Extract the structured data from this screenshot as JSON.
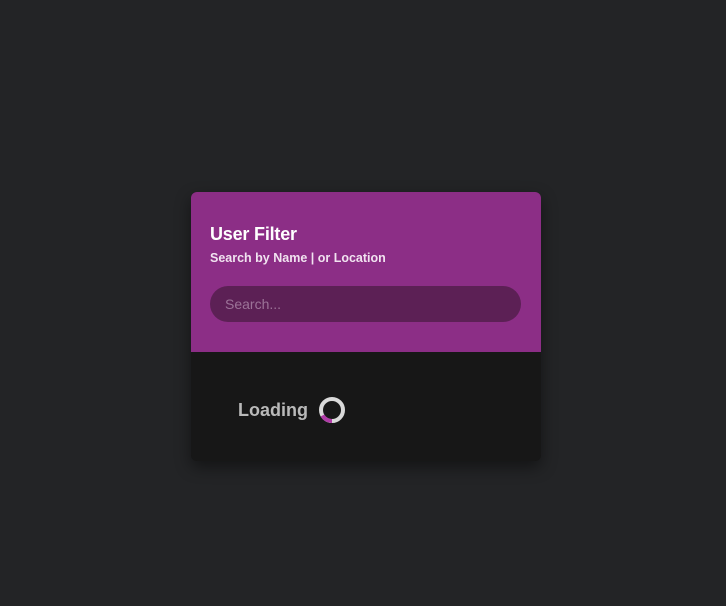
{
  "filter": {
    "title": "User Filter",
    "subtitle": "Search by Name | or Location",
    "search_placeholder": "Search...",
    "search_value": ""
  },
  "status": {
    "loading_label": "Loading",
    "spinner_icon": "loading-spinner-icon"
  },
  "colors": {
    "page_background": "#232426",
    "header_accent": "#8c2e86",
    "search_background": "#5c2055",
    "body_background": "#171717",
    "spinner_track": "#d9d9d9",
    "spinner_arc": "#b03aa7"
  }
}
